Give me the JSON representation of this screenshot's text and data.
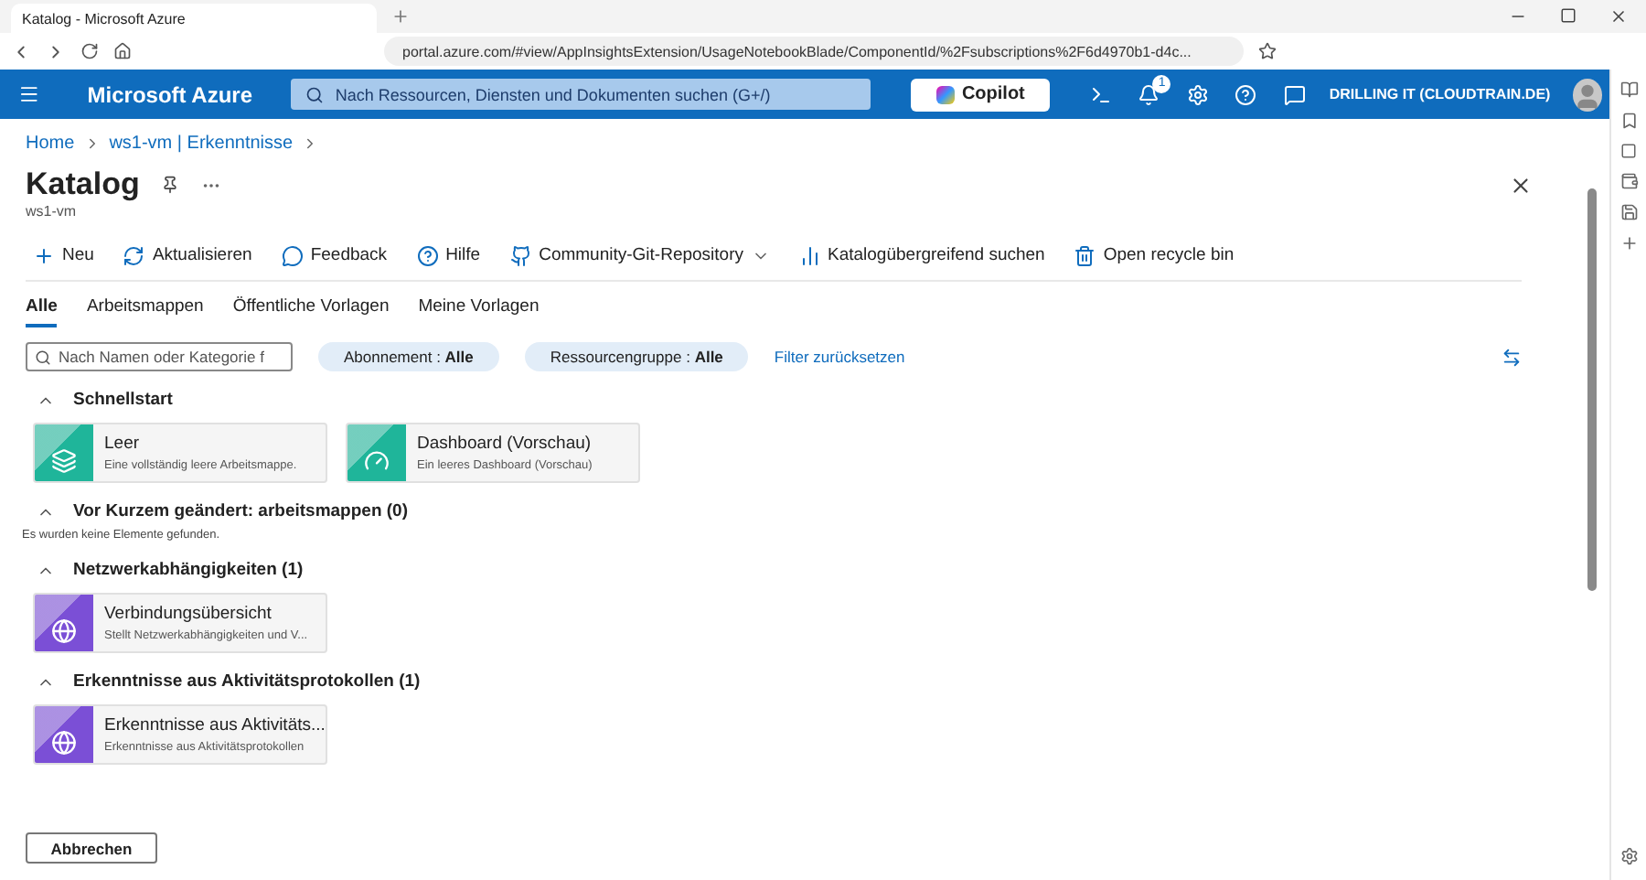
{
  "browser": {
    "tab_title": "Katalog - Microsoft Azure",
    "url": "portal.azure.com/#view/AppInsightsExtension/UsageNotebookBlade/ComponentId/%2Fsubscriptions%2F6d4970b1-d4c..."
  },
  "header": {
    "brand": "Microsoft Azure",
    "search_placeholder": "Nach Ressourcen, Diensten und Dokumenten suchen (G+/)",
    "copilot": "Copilot",
    "notification_count": "1",
    "account": "DRILLING IT (CLOUDTRAIN.DE)"
  },
  "breadcrumb": [
    "Home",
    "ws1-vm | Erkenntnisse"
  ],
  "blade": {
    "title": "Katalog",
    "subtitle": "ws1-vm"
  },
  "toolbar": [
    {
      "kind": "plus",
      "label": "Neu"
    },
    {
      "kind": "refresh",
      "label": "Aktualisieren"
    },
    {
      "kind": "feedback",
      "label": "Feedback"
    },
    {
      "kind": "help",
      "label": "Hilfe"
    },
    {
      "kind": "github",
      "label": "Community-Git-Repository",
      "dropdown": true
    },
    {
      "kind": "chart",
      "label": "Katalogübergreifend suchen"
    },
    {
      "kind": "bin",
      "label": "Open recycle bin"
    }
  ],
  "tabs": [
    {
      "label": "Alle",
      "selected": true
    },
    {
      "label": "Arbeitsmappen",
      "selected": false
    },
    {
      "label": "Öffentliche Vorlagen",
      "selected": false
    },
    {
      "label": "Meine Vorlagen",
      "selected": false
    }
  ],
  "filter": {
    "search_placeholder": "Nach Namen oder Kategorie f",
    "pills": [
      {
        "label": "Abonnement : ",
        "value": "Alle"
      },
      {
        "label": "Ressourcengruppe : ",
        "value": "Alle"
      }
    ],
    "reset": "Filter zurücksetzen"
  },
  "sections": [
    {
      "title": "Schnellstart",
      "expanded": true,
      "cards": [
        {
          "title": "Leer",
          "description": "Eine vollständig leere Arbeitsmappe.",
          "kind": "layers",
          "color": "#1fb59a"
        },
        {
          "title": "Dashboard (Vorschau)",
          "description": "Ein leeres Dashboard (Vorschau)",
          "kind": "gauge",
          "color": "#1fb59a"
        }
      ]
    },
    {
      "title": "Vor Kurzem geändert: arbeitsmappen (0)",
      "expanded": true,
      "empty_message": "Es wurden keine Elemente gefunden."
    },
    {
      "title": "Netzwerkabhängigkeiten (1)",
      "expanded": true,
      "cards": [
        {
          "title": "Verbindungsübersicht",
          "description": "Stellt Netzwerkabhängigkeiten und V...",
          "kind": "globe",
          "color": "#7b4fd6"
        }
      ]
    },
    {
      "title": "Erkenntnisse aus Aktivitätsprotokollen (1)",
      "expanded": true,
      "cards": [
        {
          "title": "Erkenntnisse aus Aktivitäts...",
          "description": "Erkenntnisse aus Aktivitätsprotokollen",
          "kind": "globe",
          "color": "#7b4fd6"
        }
      ]
    }
  ],
  "cancel": "Abbrechen"
}
